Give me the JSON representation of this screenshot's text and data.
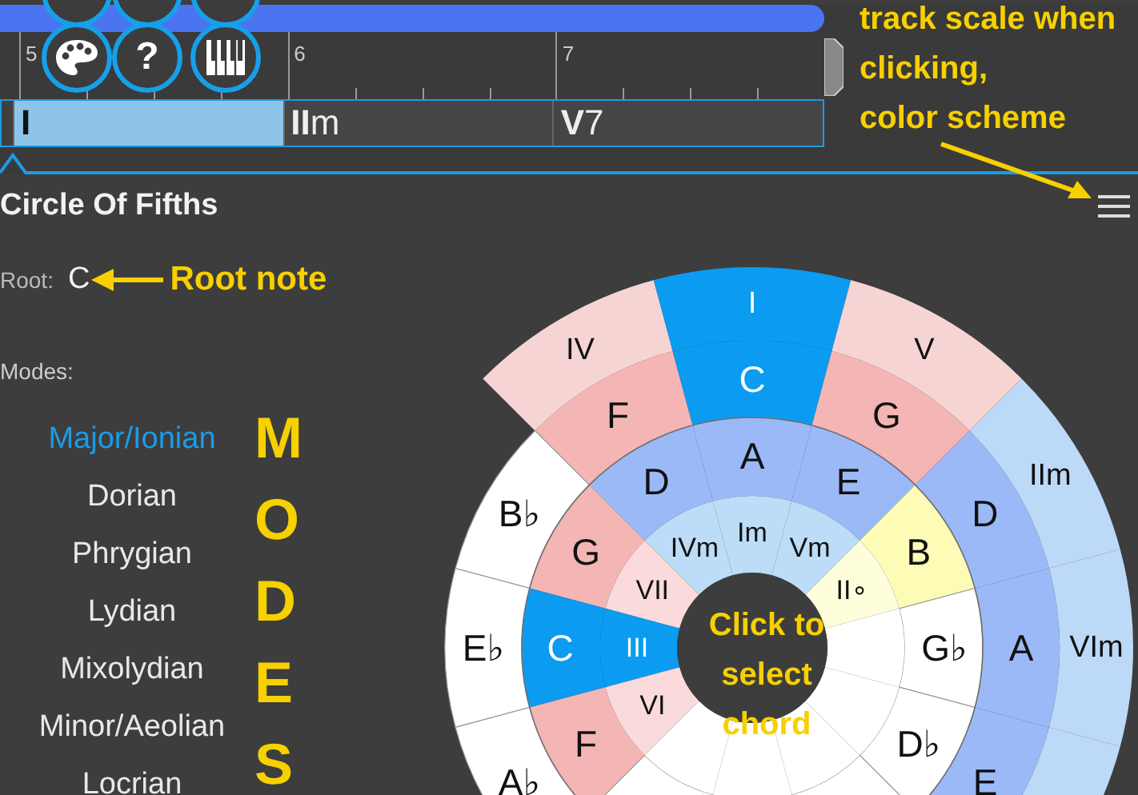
{
  "track_bar": {
    "level": 0.724
  },
  "tool_buttons": [
    {
      "kind": "palette"
    },
    {
      "kind": "help",
      "label": "?"
    },
    {
      "kind": "piano"
    }
  ],
  "timeline": {
    "bar_numbers": [
      "5",
      "6",
      "7"
    ],
    "chords": [
      {
        "numeral": "I",
        "selected": true
      },
      {
        "numeral": "II",
        "suffix": "m",
        "selected": false
      },
      {
        "numeral": "V",
        "suffix": "7",
        "selected": false
      }
    ]
  },
  "annotations": {
    "track_note": [
      "track scale when",
      "clicking,",
      "color scheme"
    ],
    "root_note": "Root note",
    "modes": "MODES",
    "click_chord": [
      "Click to",
      "select",
      "chord"
    ]
  },
  "panel": {
    "title": "Circle Of Fifths",
    "root_label": "Root:",
    "root_value": "C",
    "modes_label": "Modes:",
    "modes": [
      {
        "label": "Major/Ionian",
        "selected": true
      },
      {
        "label": "Dorian",
        "selected": false
      },
      {
        "label": "Phrygian",
        "selected": false
      },
      {
        "label": "Lydian",
        "selected": false
      },
      {
        "label": "Mixolydian",
        "selected": false
      },
      {
        "label": "Minor/Aeolian",
        "selected": false
      },
      {
        "label": "Locrian",
        "selected": false
      }
    ]
  },
  "wheel": {
    "outer_left": [
      {
        "note": "F",
        "degree": "IV",
        "kind": "major"
      },
      {
        "note": "B♭",
        "kind": "none"
      },
      {
        "note": "E♭",
        "kind": "none"
      },
      {
        "note": "A♭",
        "kind": "none"
      },
      {
        "kind": "none"
      }
    ],
    "outer_right": [
      {
        "note": "C",
        "degree": "I",
        "kind": "tonic"
      },
      {
        "note": "G",
        "degree": "V",
        "kind": "major"
      },
      {
        "note": "D",
        "degree": "IIm",
        "kind": "minor"
      },
      {
        "note": "A",
        "degree": "VIm",
        "kind": "minor"
      },
      {
        "note": "E",
        "kind": "minor"
      },
      {
        "kind": "none"
      },
      {
        "kind": "none"
      }
    ],
    "inner_left": [
      {
        "note": "D",
        "degree": "IVm",
        "kind": "minor"
      },
      {
        "note": "G",
        "degree": "VII",
        "kind": "major"
      },
      {
        "note": "C",
        "degree": "III",
        "kind": "tonic"
      },
      {
        "note": "F",
        "degree": "VI",
        "kind": "major"
      },
      {
        "kind": "none"
      }
    ],
    "inner_right": [
      {
        "note": "A",
        "degree": "Im",
        "kind": "minor"
      },
      {
        "note": "E",
        "degree": "Vm",
        "kind": "minor"
      },
      {
        "note": "B",
        "degree": "II∘",
        "kind": "dim"
      },
      {
        "note": "G♭",
        "kind": "none"
      },
      {
        "note": "D♭",
        "kind": "none"
      },
      {
        "kind": "none"
      },
      {
        "kind": "none"
      }
    ]
  }
}
